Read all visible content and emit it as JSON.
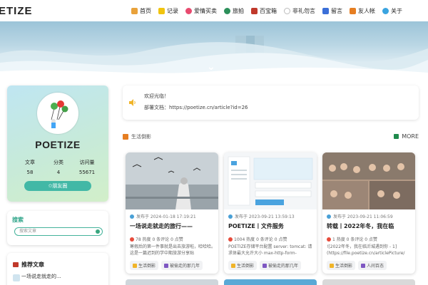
{
  "header": {
    "logo": "ETIZE",
    "nav": [
      {
        "label": "首页",
        "icon": "home-icon",
        "color": "#e9a23b"
      },
      {
        "label": "记录",
        "icon": "notebook-icon",
        "color": "#f1c40f"
      },
      {
        "label": "爱情买卖",
        "icon": "heart-icon",
        "color": "#e84a6f"
      },
      {
        "label": "旅拍",
        "icon": "camera-icon",
        "color": "#2c8f5a"
      },
      {
        "label": "百宝箱",
        "icon": "toolbox-icon",
        "color": "#c0392b"
      },
      {
        "label": "非礼勿言",
        "icon": "chat-bubble-icon",
        "color": "#bbbbbb"
      },
      {
        "label": "留言",
        "icon": "message-icon",
        "color": "#3b6fd8"
      },
      {
        "label": "友人帐",
        "icon": "friends-icon",
        "color": "#e67e22"
      },
      {
        "label": "关于",
        "icon": "about-icon",
        "color": "#3aa4e0"
      }
    ]
  },
  "profile": {
    "name": "POETIZE",
    "stats": [
      {
        "label": "文章",
        "value": "58"
      },
      {
        "label": "分类",
        "value": "4"
      },
      {
        "label": "访问量",
        "value": "55671"
      }
    ],
    "friend_button": "✩朋友圈"
  },
  "search": {
    "title": "搜索",
    "placeholder": "搜索文章"
  },
  "recommend": {
    "title": "推荐文章",
    "items": [
      "一场说走就走的..."
    ]
  },
  "notice": {
    "line1": "欢迎光临！",
    "line2": "部署文档：https://poetize.cn/article?id=26"
  },
  "section": {
    "title": "生活倒影",
    "more": "MORE"
  },
  "articles": [
    {
      "date": "发布于 2024-01-18 17:19:21",
      "title": "一场说走就走的旅行——",
      "counts": "78 热度   0 条评论   0 点赞",
      "summary": "寒假后的第一件事就是出去旅游啦，哈哈哈。这是一篇迟到的学中期旅游分享贴",
      "tags": [
        "生活倒影",
        "被偷走的那几年"
      ]
    },
    {
      "date": "发布于 2023-09-21 13:59:13",
      "title": "POETIZE丨文件服务",
      "counts": "1004 热度   0 条评论   0 点赞",
      "summary": "POETIZE存储平台配置 server: tomcat: 请求体最大允许大小 max-http-form-",
      "tags": [
        "生活倒影",
        "被偷走的那几年"
      ]
    },
    {
      "date": "发布于 2023-09-21 11:06:59",
      "title": "转载丨2022年冬，我在临",
      "counts": "1 热度   0 条评论   0 点赞",
      "summary": "![2022年冬，我在临沂城遇到你 - 1](https://file.poetize.cn/articlePicture/",
      "tags": [
        "生活倒影",
        "人间百态"
      ]
    }
  ]
}
